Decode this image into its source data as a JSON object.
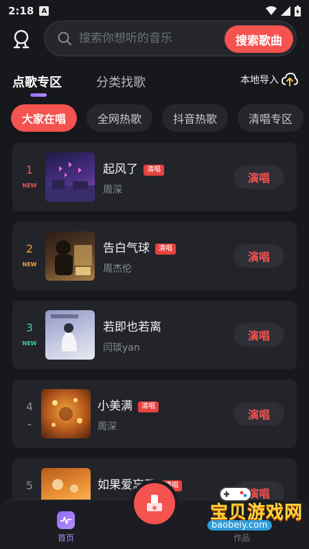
{
  "status_bar": {
    "time": "2:18",
    "badge": "A"
  },
  "search": {
    "placeholder": "搜索你想听的音乐",
    "button_label": "搜索歌曲"
  },
  "tabs": {
    "active": "点歌专区",
    "inactive": "分类找歌",
    "local_import": "本地导入"
  },
  "chips": [
    "大家在唱",
    "全网热歌",
    "抖音热歌",
    "清唱专区"
  ],
  "songs": [
    {
      "rank": "1",
      "new": "NEW",
      "title": "起风了",
      "badge": "清唱",
      "artist": "周深",
      "rank_color": "#f4534f",
      "cover": [
        "#2c2a6b",
        "#6a3fa4",
        "#b057c9"
      ]
    },
    {
      "rank": "2",
      "new": "NEW",
      "title": "告白气球",
      "badge": "清唱",
      "artist": "周杰伦",
      "rank_color": "#f0a043",
      "cover": [
        "#3b2a20",
        "#6d4b2d",
        "#c79a4e"
      ]
    },
    {
      "rank": "3",
      "new": "NEW",
      "title": "若即也若离",
      "badge": "",
      "artist": "闫琰yan",
      "rank_color": "#3ecf8e",
      "cover": [
        "#9ea4c9",
        "#c9cde6",
        "#e4e5ef"
      ]
    },
    {
      "rank": "4",
      "new": "–",
      "title": "小美满",
      "badge": "清唱",
      "artist": "周深",
      "rank_color": "#8c8e96",
      "cover": [
        "#5a2a12",
        "#b5561f",
        "#f0a63a"
      ]
    },
    {
      "rank": "5",
      "new": "",
      "title": "如果爱忘了",
      "badge": "清唱",
      "artist": "",
      "rank_color": "#8c8e96",
      "cover": [
        "#c76a1e",
        "#f2a041",
        "#f8d27a"
      ]
    }
  ],
  "sing_label": "演唱",
  "bottom_nav": {
    "home_label": "首页",
    "sing_label": "作品"
  },
  "watermark": {
    "title": "宝贝游戏网",
    "url": "baobeiy.com"
  },
  "colors": {
    "accent": "#f4534f",
    "purple": "#8b6cf5",
    "background": "#17181c",
    "card": "#22242a"
  }
}
